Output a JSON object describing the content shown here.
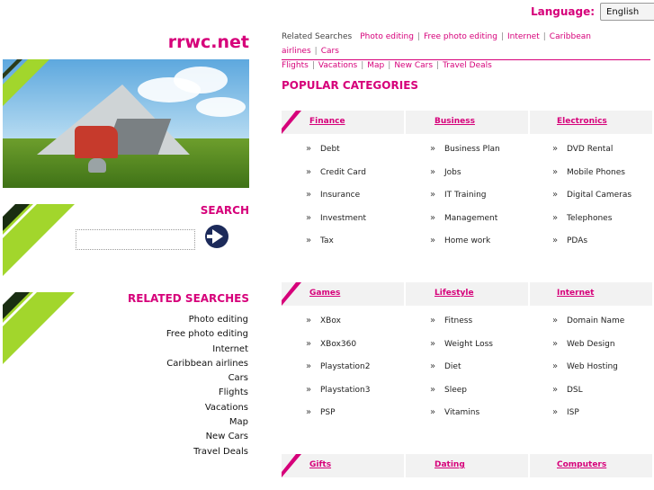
{
  "language": {
    "label": "Language:",
    "selected": "English"
  },
  "site": {
    "logo": "rrwc.net"
  },
  "search": {
    "title": "SEARCH",
    "placeholder": ""
  },
  "left_related": {
    "title": "RELATED SEARCHES",
    "items": [
      "Photo editing",
      "Free photo editing",
      "Internet",
      "Caribbean airlines",
      "Cars",
      "Flights",
      "Vacations",
      "Map",
      "New Cars",
      "Travel Deals"
    ]
  },
  "top_related": {
    "label": "Related Searches",
    "links": [
      "Photo editing",
      "Free photo editing",
      "Internet",
      "Caribbean airlines",
      "Cars",
      "Flights",
      "Vacations",
      "Map",
      "New Cars",
      "Travel Deals"
    ]
  },
  "popular": {
    "title": "POPULAR CATEGORIES",
    "groups": [
      {
        "columns": [
          {
            "title": "Finance",
            "items": [
              "Debt",
              "Credit Card",
              "Insurance",
              "Investment",
              "Tax"
            ]
          },
          {
            "title": "Business",
            "items": [
              "Business Plan",
              "Jobs",
              "IT Training",
              "Management",
              "Home work"
            ]
          },
          {
            "title": "Electronics",
            "items": [
              "DVD Rental",
              "Mobile Phones",
              "Digital Cameras",
              "Telephones",
              "PDAs"
            ]
          }
        ]
      },
      {
        "columns": [
          {
            "title": "Games",
            "items": [
              "XBox",
              "XBox360",
              "Playstation2",
              "Playstation3",
              "PSP"
            ]
          },
          {
            "title": "Lifestyle",
            "items": [
              "Fitness",
              "Weight Loss",
              "Diet",
              "Sleep",
              "Vitamins"
            ]
          },
          {
            "title": "Internet",
            "items": [
              "Domain Name",
              "Web Design",
              "Web Hosting",
              "DSL",
              "ISP"
            ]
          }
        ]
      },
      {
        "columns": [
          {
            "title": "Gifts",
            "items": []
          },
          {
            "title": "Dating",
            "items": []
          },
          {
            "title": "Computers",
            "items": []
          }
        ]
      }
    ]
  },
  "colors": {
    "accent": "#d6007a",
    "green": "#a2d62c",
    "header_bg": "#f2f2f2",
    "search_button": "#1c2a5a"
  }
}
